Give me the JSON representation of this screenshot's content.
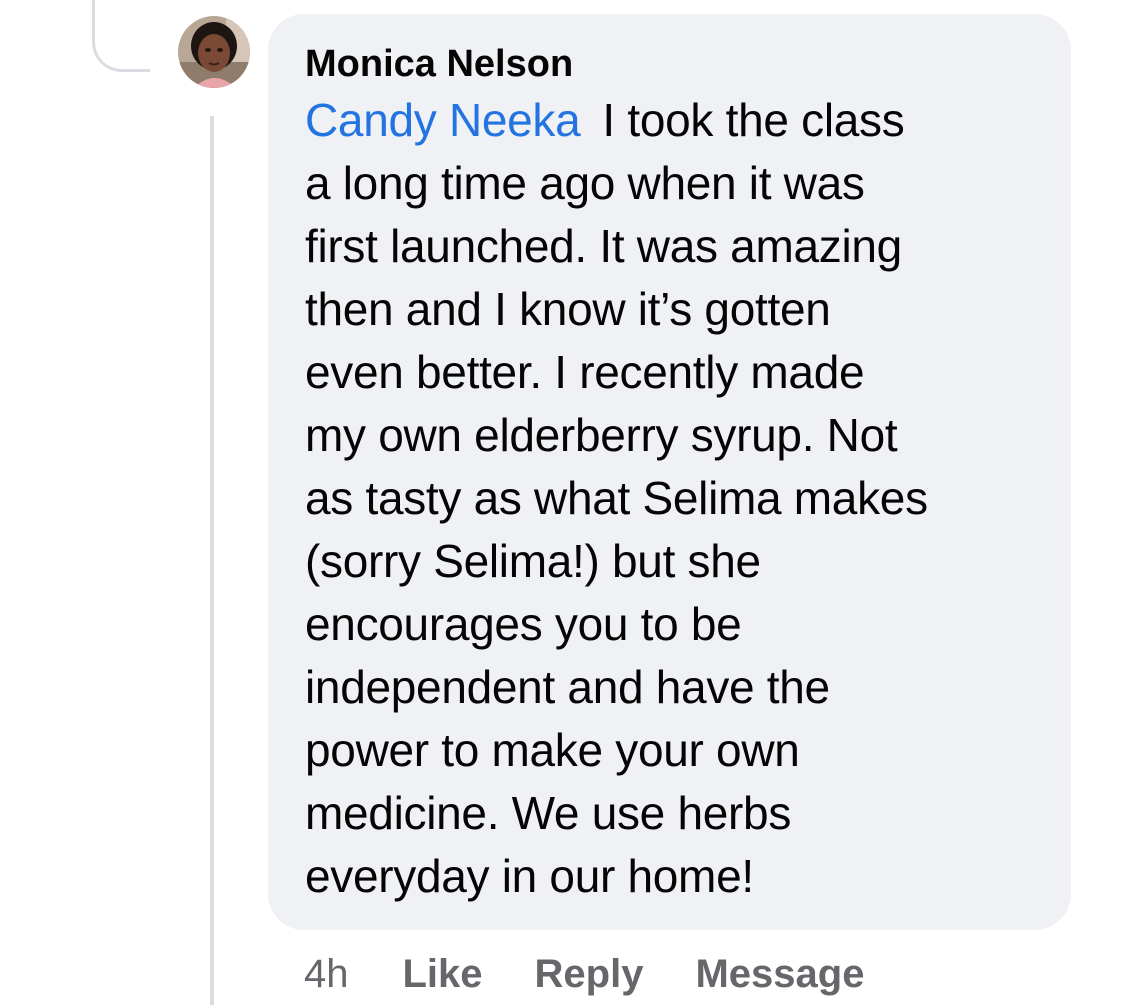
{
  "comment": {
    "author": "Monica Nelson",
    "mention": "Candy Neeka",
    "lines": [
      "I took the class",
      "a long time ago when it was",
      "first launched. It was amazing",
      "then and I know it’s gotten",
      "even better. I recently made",
      "my own elderberry syrup. Not",
      "as tasty as what Selima makes",
      "(sorry Selima!) but she",
      "encourages you to be",
      "independent and have the",
      "power to make your own",
      "medicine. We use herbs",
      "everyday in our home!"
    ]
  },
  "actions": {
    "timestamp": "4h",
    "like": "Like",
    "reply": "Reply",
    "message": "Message"
  },
  "colors": {
    "bubble": "#eff1f4",
    "mention": "#2374e1",
    "meta": "#65676b",
    "thread": "#d9dce1"
  }
}
